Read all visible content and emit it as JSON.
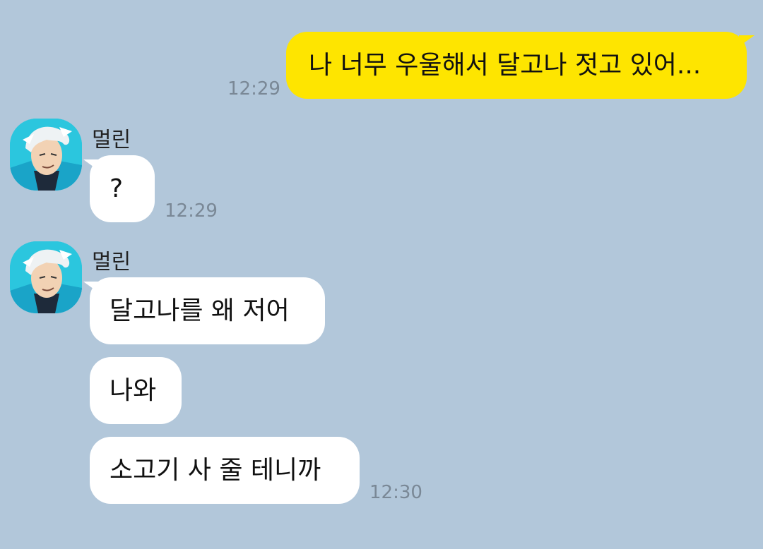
{
  "colors": {
    "background": "#b2c7da",
    "my_bubble": "#fee500",
    "their_bubble": "#ffffff",
    "timestamp": "#7a8896"
  },
  "messages": {
    "outgoing": {
      "text": "나 너무 우울해서 달고나 젓고 있어...",
      "time": "12:29"
    },
    "group1": {
      "sender": "멀린",
      "avatar_icon": "character-avatar-icon",
      "bubbles": [
        "?"
      ],
      "time": "12:29"
    },
    "group2": {
      "sender": "멀린",
      "avatar_icon": "character-avatar-icon",
      "bubbles": [
        "달고나를 왜 저어",
        "나와",
        "소고기 사 줄 테니까"
      ],
      "time": "12:30"
    }
  }
}
